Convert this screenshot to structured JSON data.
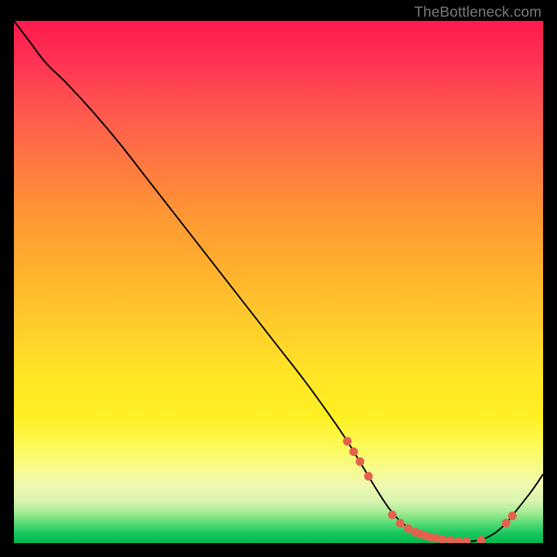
{
  "watermark": "TheBottleneck.com",
  "colors": {
    "gradient_top": "#ff1a4d",
    "gradient_mid": "#ffe626",
    "gradient_bottom": "#00b84c",
    "curve": "#000000",
    "marker_fill": "#e3624e",
    "marker_stroke": "#c84b3a"
  },
  "chart_data": {
    "type": "line",
    "title": "",
    "xlabel": "",
    "ylabel": "",
    "xlim": [
      0,
      100
    ],
    "ylim": [
      0,
      100
    ],
    "grid": false,
    "series": [
      {
        "name": "bottleneck-curve",
        "x": [
          0,
          3,
          6,
          10,
          15,
          20,
          25,
          30,
          35,
          40,
          45,
          50,
          55,
          60,
          63,
          66,
          69,
          71,
          73,
          75,
          77,
          79,
          81,
          83,
          85,
          87,
          89,
          91,
          93,
          95,
          98,
          100
        ],
        "y": [
          100,
          96,
          92,
          88,
          82.5,
          76.5,
          70,
          63.5,
          57,
          50.5,
          44,
          37.5,
          31,
          24,
          19.5,
          14.5,
          9.5,
          6.5,
          4.2,
          2.7,
          1.6,
          0.9,
          0.5,
          0.3,
          0.25,
          0.4,
          0.9,
          2.0,
          3.8,
          6.3,
          10.2,
          13.2
        ]
      }
    ],
    "markers": {
      "name": "highlight-points",
      "x": [
        63.0,
        64.2,
        65.4,
        67.0,
        71.5,
        73.0,
        74.5,
        75.8,
        76.8,
        77.8,
        78.8,
        79.8,
        81.0,
        82.5,
        84.0,
        85.5,
        88.3,
        93.0,
        94.2
      ],
      "y": [
        19.5,
        17.5,
        15.6,
        12.8,
        5.4,
        3.8,
        2.8,
        2.1,
        1.7,
        1.4,
        1.1,
        0.9,
        0.7,
        0.5,
        0.35,
        0.3,
        0.5,
        3.8,
        5.2
      ]
    }
  }
}
